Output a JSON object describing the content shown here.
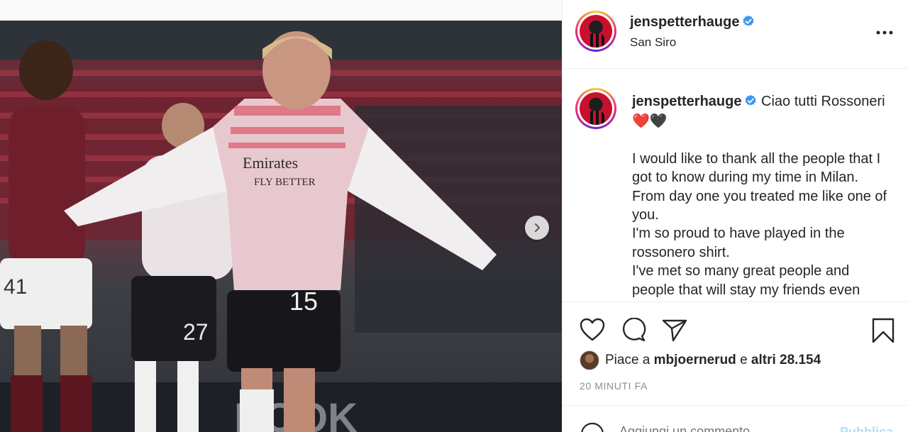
{
  "post": {
    "username": "jenspetterhauge",
    "location": "San Siro",
    "verified": true
  },
  "caption": {
    "username": "jenspetterhauge",
    "text_first": "Ciao tutti Rossoneri❤️🖤",
    "body": "I would like to thank all the people that I got to know during my time in Milan. From day one you treated me like one of you.\nI'm so proud to have played in the rossonero shirt.\nI've met so many great people and people that will stay my friends even"
  },
  "likes": {
    "prefix": "Piace a",
    "user": "mbjoernerud",
    "joiner": "e",
    "others": "altri 28.154"
  },
  "timestamp": "20 MINUTI FA",
  "comment": {
    "placeholder": "Aggiungi un commento...",
    "publish_label": "Pubblica"
  },
  "carousel": {
    "total_slides": 4,
    "active_slide": 1
  },
  "icons": {
    "verified": "verified-badge-icon",
    "more": "more-options-icon",
    "like": "heart-icon",
    "comment": "comment-bubble-icon",
    "share": "paper-plane-icon",
    "save": "bookmark-icon",
    "next": "chevron-right-icon",
    "emoji": "emoji-smiley-icon"
  },
  "colors": {
    "verified_blue": "#3897f0",
    "text": "#262626",
    "muted": "#8e8e8e",
    "publish": "#b2dffc"
  }
}
